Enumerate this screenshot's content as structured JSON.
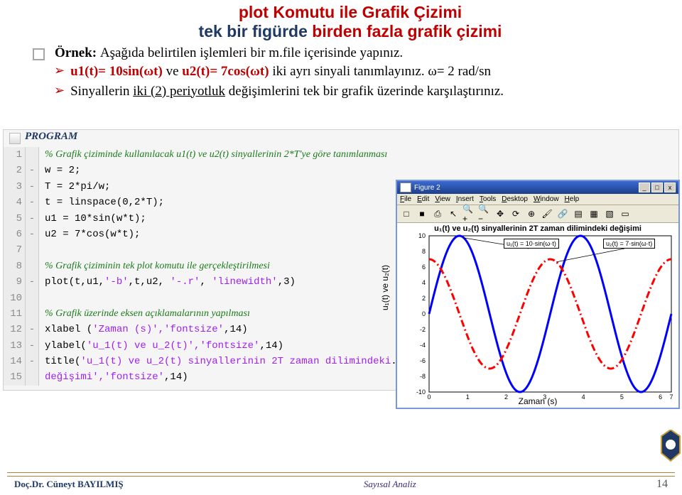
{
  "heading": {
    "line1": "plot Komutu ile Grafik Çizimi",
    "line2_navy": "tek bir figürde ",
    "line2_red": "birden fazla grafik çizimi"
  },
  "ornek": {
    "lead": "Örnek: ",
    "rest": "Aşağıda belirtilen işlemleri bir m.file içerisinde yapınız."
  },
  "arrow1": {
    "red_a": "u1(t)= 10sin(ωt) ",
    "mid": "ve ",
    "red_b": "u2(t)= 7cos(ωt) ",
    "tail": "iki ayrı sinyali tanımlayınız.   ω= 2 rad/sn"
  },
  "arrow2": {
    "pre": "Sinyallerin ",
    "ul": "iki (2) periyotluk",
    "post": " değişimlerini tek bir grafik üzerinde karşılaştırınız."
  },
  "program_label": "PROGRAM",
  "code": [
    {
      "n": "1",
      "g": "",
      "body": "% Grafik çiziminde kullanılacak u1(t) ve u2(t) sinyallerinin 2*T'ye göre tanımlanması",
      "cls": "comment"
    },
    {
      "n": "2",
      "g": "-",
      "body": "w = 2;",
      "cls": "kw"
    },
    {
      "n": "3",
      "g": "-",
      "body": "T = 2*pi/w;",
      "cls": "kw"
    },
    {
      "n": "4",
      "g": "-",
      "body": "t = linspace(0,2*T);",
      "cls": "kw"
    },
    {
      "n": "5",
      "g": "-",
      "body": "u1 = 10*sin(w*t);",
      "cls": "kw"
    },
    {
      "n": "6",
      "g": "-",
      "body": "u2 = 7*cos(w*t);",
      "cls": "kw"
    },
    {
      "n": "7",
      "g": "",
      "body": "",
      "cls": "kw"
    },
    {
      "n": "8",
      "g": "",
      "body": "% Grafik çiziminin tek plot komutu ile gerçekleştirilmesi",
      "cls": "comment"
    },
    {
      "n": "9",
      "g": "-",
      "html": "plot(t,u1,<span class=\"str\">'-b'</span>,t,u2, <span class=\"str\">'-.r'</span>, <span class=\"str\">'linewidth'</span>,3)"
    },
    {
      "n": "10",
      "g": "",
      "body": "",
      "cls": "kw"
    },
    {
      "n": "11",
      "g": "",
      "body": "% Grafik üzerinde eksen açıklamalarının yapılması",
      "cls": "comment"
    },
    {
      "n": "12",
      "g": "-",
      "html": "xlabel (<span class=\"str\">'Zaman (s)','fontsize'</span>,14)"
    },
    {
      "n": "13",
      "g": "-",
      "html": "ylabel(<span class=\"str\">'u_1(t) ve u_2(t)','fontsize'</span>,14)"
    },
    {
      "n": "14",
      "g": "-",
      "html": "title(<span class=\"str\">'u_1(t) ve u_2(t) sinyallerinin 2T  zaman dilimindeki</span>..."
    },
    {
      "n": "15",
      "g": "",
      "html": "      <span class=\"str\">değişimi','fontsize'</span>,14)   "
    }
  ],
  "figure": {
    "title": "Figure 2",
    "menu": [
      "File",
      "Edit",
      "View",
      "Insert",
      "Tools",
      "Desktop",
      "Window",
      "Help"
    ],
    "toolbar_icons": [
      "new-icon",
      "save-icon",
      "print-icon",
      "pointer-icon",
      "zoom-in-icon",
      "zoom-out-icon",
      "pan-icon",
      "rotate-icon",
      "data-cursor-icon",
      "brush-icon",
      "link-icon",
      "colorbar-icon",
      "legend-icon",
      "grid-icon",
      "axes-icon"
    ],
    "plot_title": "u₁(t) ve u₂(t) sinyallerinin 2T  zaman dilimindeki değişimi",
    "xlabel": "Zaman (s)",
    "ylabel": "u₁(t) ve u₂(t)",
    "callout1": "u₁(t) = 10·sin(ω·t)",
    "callout2": "u₂(t) = 7·sin(ω·t)",
    "yticks": [
      "10",
      "8",
      "6",
      "4",
      "2",
      "0",
      "-2",
      "-4",
      "-6",
      "-8",
      "-10"
    ],
    "xticks": [
      "0",
      "1",
      "2",
      "3",
      "4",
      "5",
      "6",
      "7"
    ]
  },
  "chart_data": {
    "type": "line",
    "title": "u₁(t) ve u₂(t) sinyallerinin 2T zaman dilimindeki değişimi",
    "xlabel": "Zaman (s)",
    "ylabel": "u₁(t) ve u₂(t)",
    "xlim": [
      0,
      6.2832
    ],
    "ylim": [
      -10,
      10
    ],
    "xticks": [
      0,
      1,
      2,
      3,
      4,
      5,
      6,
      7
    ],
    "yticks": [
      -10,
      -8,
      -6,
      -4,
      -2,
      0,
      2,
      4,
      6,
      8,
      10
    ],
    "series": [
      {
        "name": "u₁(t) = 10·sin(ω·t)",
        "color": "#0000ff",
        "style": "solid",
        "formula": "10*sin(2*t)",
        "x": [
          0,
          0.5,
          1,
          1.5,
          2,
          2.5,
          3,
          3.5,
          4,
          4.5,
          5,
          5.5,
          6,
          6.2832
        ],
        "y": [
          0,
          8.41,
          9.09,
          1.41,
          -7.57,
          -9.59,
          -2.79,
          6.57,
          9.89,
          4.12,
          -5.44,
          -10,
          -5.37,
          0
        ]
      },
      {
        "name": "u₂(t) = 7·cos(ω·t)",
        "color": "#ff0000",
        "style": "dash-dot",
        "formula": "7*cos(2*t)",
        "x": [
          0,
          0.5,
          1,
          1.5,
          2,
          2.5,
          3,
          3.5,
          4,
          4.5,
          5,
          5.5,
          6,
          6.2832
        ],
        "y": [
          7,
          3.78,
          -2.91,
          -6.93,
          -4.58,
          1.99,
          6.72,
          5.27,
          -1.02,
          -6.38,
          -5.87,
          0.03,
          5.91,
          7
        ]
      }
    ],
    "annotations": [
      {
        "text": "u₁(t) = 10·sin(ω·t)",
        "target_series": 0
      },
      {
        "text": "u₂(t) = 7·sin(ω·t)",
        "target_series": 1
      }
    ]
  },
  "footer": {
    "left": "Doç.Dr. Cüneyt BAYILMIŞ",
    "center": "Sayısal Analiz",
    "right": "14"
  }
}
